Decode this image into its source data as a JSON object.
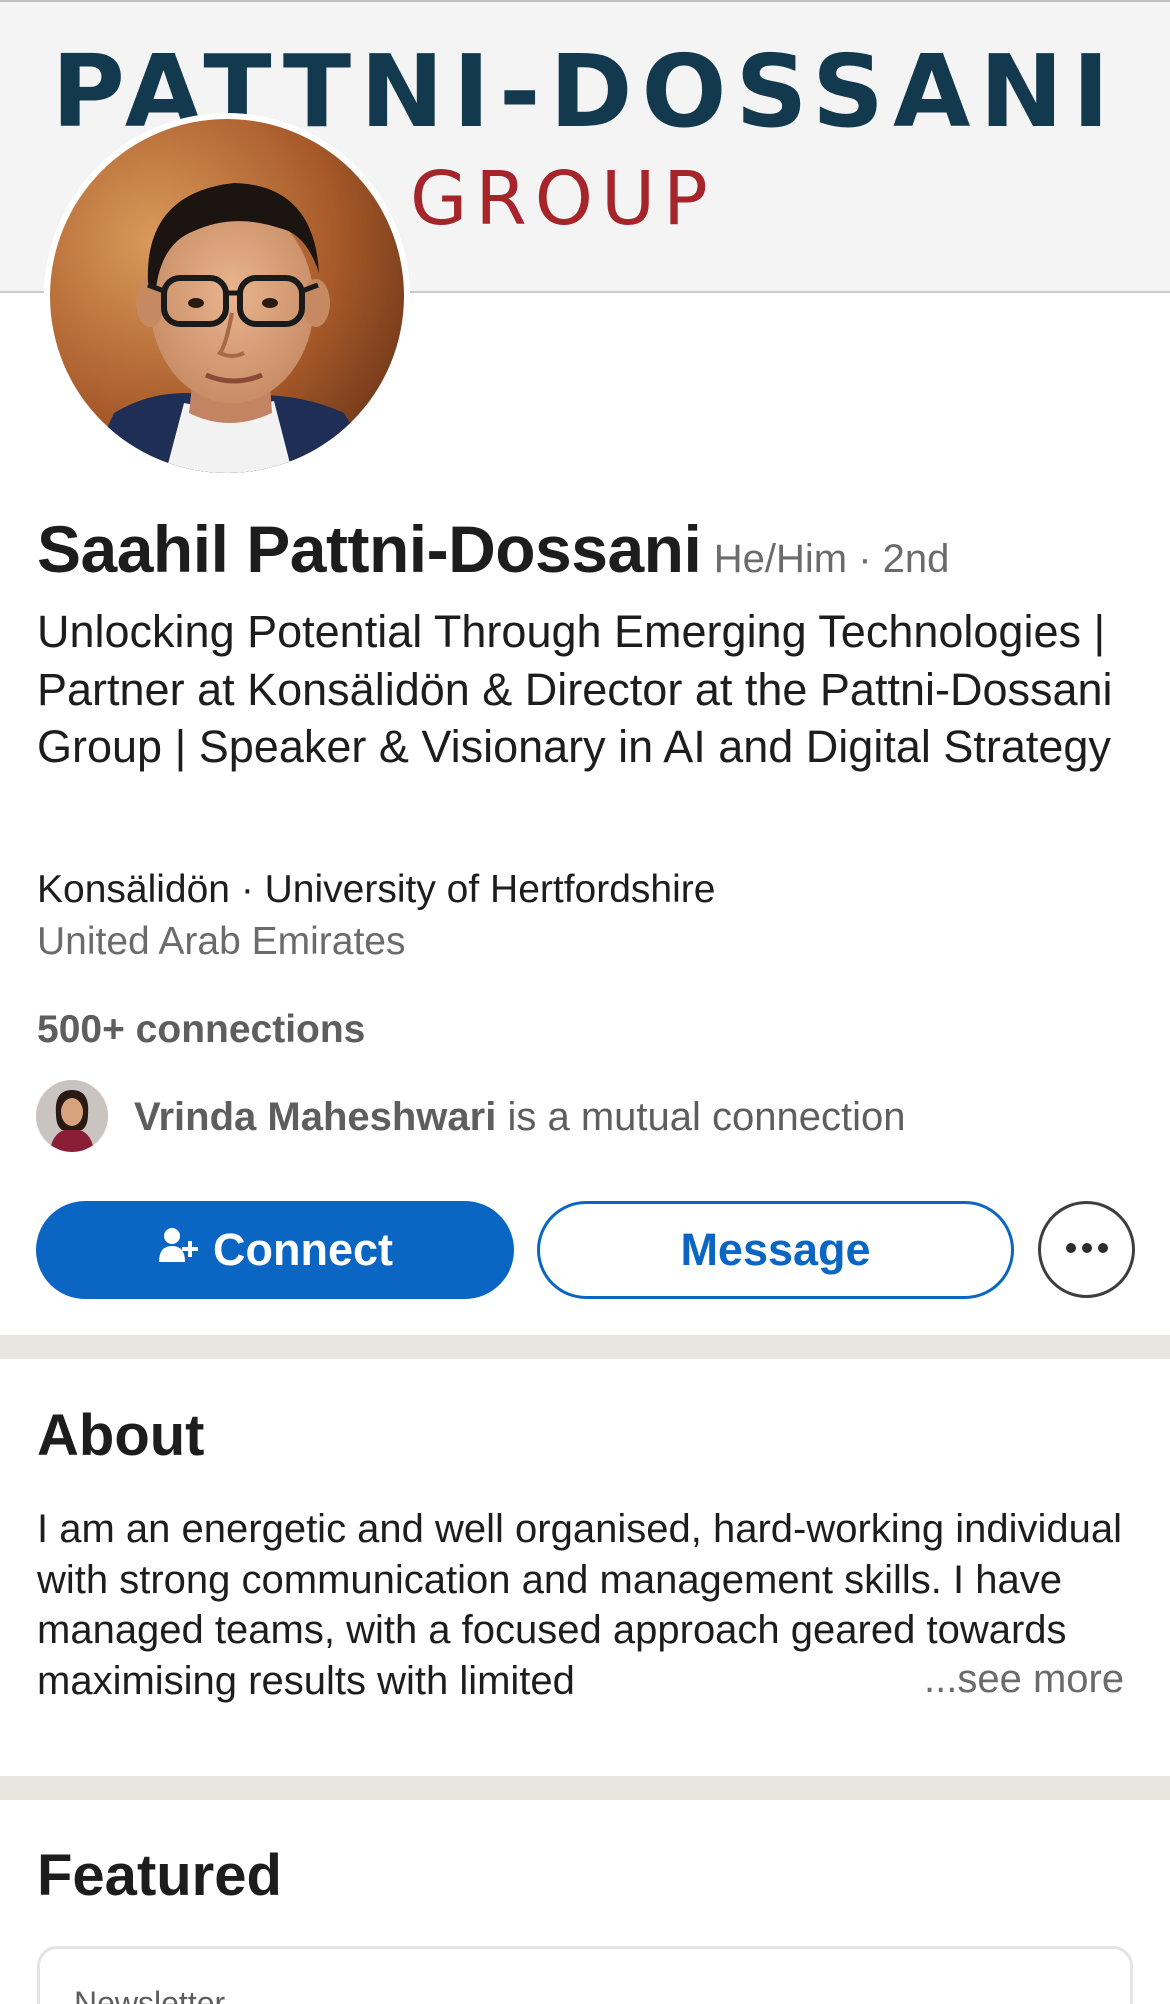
{
  "banner": {
    "logo_line1": "PATTNI-DOSSANI",
    "logo_line2": "GROUP"
  },
  "profile": {
    "name": "Saahil Pattni-Dossani",
    "pronoun_degree": "He/Him · 2nd",
    "headline": "Unlocking Potential Through Emerging Technologies | Partner at Konsälidön & Director at the Pattni-Dossani Group | Speaker & Visionary in AI and Digital Strategy",
    "company_education": "Konsälidön · University of Hertfordshire",
    "location": "United Arab Emirates",
    "connections": "500+ connections",
    "mutual": {
      "name": "Vrinda Maheshwari",
      "suffix": " is a mutual connection"
    }
  },
  "actions": {
    "connect_label": "Connect",
    "message_label": "Message",
    "more_icon": "ellipsis-icon",
    "connect_icon": "add-person-icon"
  },
  "about": {
    "title": "About",
    "text": "I am an energetic and well organised, hard-working individual with strong communication and management skills. I have managed teams, with a focused approach geared towards maximising results with limited",
    "see_more": "...see more"
  },
  "featured": {
    "title": "Featured",
    "card_label": "Newsletter"
  },
  "colors": {
    "primary": "#0a66c2",
    "logo_navy": "#13394f",
    "logo_red": "#a5252b",
    "divider": "#e8e6df"
  }
}
